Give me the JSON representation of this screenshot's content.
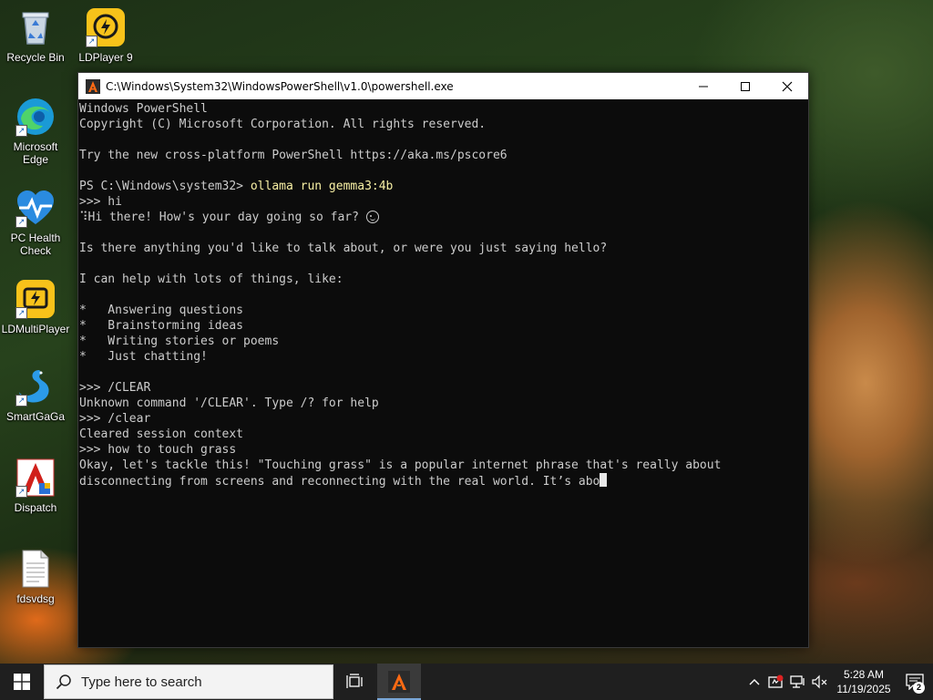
{
  "desktop": {
    "icons": [
      {
        "label": "Recycle Bin"
      },
      {
        "label": "LDPlayer 9"
      },
      {
        "label": "Microsoft Edge"
      },
      {
        "label": "PC Health Check"
      },
      {
        "label": "LDMultiPlayer"
      },
      {
        "label": "SmartGaGa"
      },
      {
        "label": "Dispatch"
      },
      {
        "label": "fdsvdsg"
      }
    ]
  },
  "window": {
    "title": "C:\\Windows\\System32\\WindowsPowerShell\\v1.0\\powershell.exe",
    "console": {
      "banner1": "Windows PowerShell",
      "banner2": "Copyright (C) Microsoft Corporation. All rights reserved.",
      "banner3": "Try the new cross-platform PowerShell https://aka.ms/pscore6",
      "prompt": "PS C:\\Windows\\system32> ",
      "command": "ollama run gemma3:4b",
      "input1": ">>> hi",
      "reply1_prefix": "⠹",
      "reply1": "Hi there! How's your day going so far? ",
      "reply2": "Is there anything you'd like to talk about, or were you just saying hello?",
      "reply3": "I can help with lots of things, like:",
      "bullets": [
        "*   Answering questions",
        "*   Brainstorming ideas",
        "*   Writing stories or poems",
        "*   Just chatting!"
      ],
      "input2": ">>> /CLEAR",
      "error1": "Unknown command '/CLEAR'. Type /? for help",
      "input3": ">>> /clear",
      "info1": "Cleared session context",
      "input4": ">>> how to touch grass",
      "answer1": "Okay, let's tackle this! \"Touching grass\" is a popular internet phrase that's really about",
      "answer2": "disconnecting from screens and reconnecting with the real world. It’s abo"
    }
  },
  "taskbar": {
    "search_placeholder": "Type here to search",
    "clock_time": "5:28 AM",
    "clock_date": "11/19/2025",
    "notification_count": "2"
  },
  "colors": {
    "console_bg": "#0c0c0c",
    "console_text": "#cccccc",
    "command_text": "#f9f1a5",
    "taskbar_bg": "#1f1f1f"
  }
}
